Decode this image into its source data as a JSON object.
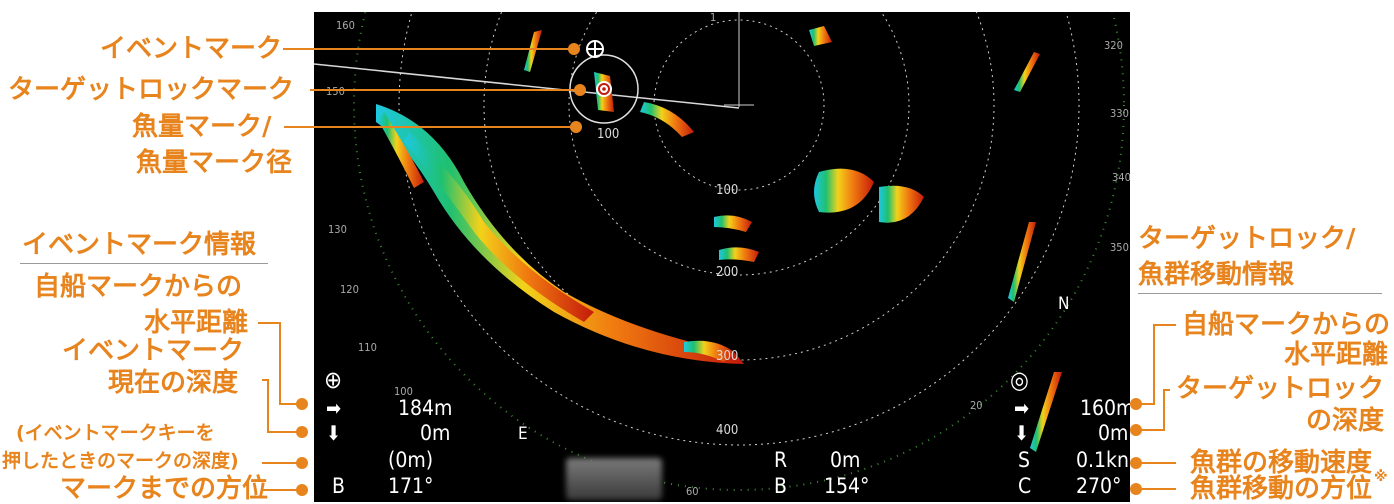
{
  "annotations": {
    "event_mark": "イベントマーク",
    "target_lock_mark": "ターゲットロックマーク",
    "fish_amount_line1": "魚量マーク/",
    "fish_amount_line2": "魚量マーク径",
    "event_info_header": "イベントマーク情報",
    "own_ship_dist_line1": "自船マークからの",
    "own_ship_dist_line2": "水平距離",
    "event_depth_line1": "イベントマーク",
    "event_depth_line2": "現在の深度",
    "event_key_line1": "(イベントマークキーを",
    "event_key_line2": "押したときのマークの深度)",
    "bearing_to_mark": "マークまでの方位",
    "target_info_line1": "ターゲットロック/",
    "target_info_line2": "魚群移動情報",
    "tl_dist_line1": "自船マークからの",
    "tl_dist_line2": "水平距離",
    "tl_depth_line1": "ターゲットロック",
    "tl_depth_line2": "の深度",
    "school_speed": "魚群の移動速度",
    "school_bearing": "魚群移動の方位",
    "note_mark": "※"
  },
  "screen": {
    "range_labels": [
      "100",
      "100",
      "200",
      "300",
      "400"
    ],
    "bearing_labels": [
      "160",
      "150",
      "130",
      "120",
      "110",
      "100",
      "320",
      "330",
      "340",
      "350",
      "60",
      "20",
      "1"
    ],
    "compass_e": "E",
    "compass_n": "N",
    "event": {
      "icon": "⊕",
      "distance": "184m",
      "depth": "0m",
      "depth_at_key": "(0m)",
      "bearing_label": "B",
      "bearing": "171°"
    },
    "center": {
      "r_label": "R",
      "r_value": "0m",
      "b_label": "B",
      "b_value": "154°"
    },
    "target": {
      "icon": "◎",
      "distance": "160m",
      "depth": "0m",
      "speed_label": "S",
      "speed": "0.1kn",
      "course_label": "C",
      "course": "270°"
    },
    "arrow_right": "➡",
    "arrow_down": "⬇"
  },
  "colors": {
    "annotation": "#e8841d",
    "screen_bg": "#000000",
    "echo_red": "#c41a0a",
    "echo_orange": "#f07a10",
    "echo_yellow": "#f2d21a",
    "echo_green": "#1fc070",
    "echo_cyan": "#1ec8e0"
  }
}
